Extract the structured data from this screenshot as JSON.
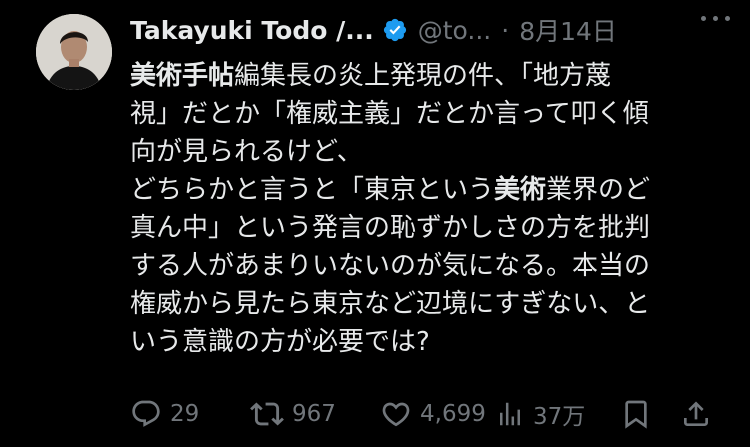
{
  "author": {
    "name": "Takayuki Todo /...",
    "handle": "@to...",
    "separator": "·",
    "date": "8月14日"
  },
  "icons": {
    "avatar": "profile-photo",
    "verified": "verified-badge-icon",
    "more": "more-dots-icon",
    "reply": "reply-icon",
    "retweet": "retweet-icon",
    "like": "heart-icon",
    "views": "views-bar-chart-icon",
    "bookmark": "bookmark-icon",
    "share": "share-icon"
  },
  "colors": {
    "background": "#000000",
    "text": "#e7e9ea",
    "muted": "#71767b",
    "verified": "#1d9bf0"
  },
  "tweet": {
    "lines": [
      [
        {
          "t": "美術手帖",
          "bold": true
        },
        {
          "t": "編集長の炎上発現の件、「地方蔑"
        }
      ],
      [
        {
          "t": "視」だとか「権威主義」だとか言って叩く傾"
        }
      ],
      [
        {
          "t": "向が見られるけど、"
        }
      ],
      [
        {
          "t": "どちらかと言うと「東京という"
        },
        {
          "t": "美術",
          "bold": true
        },
        {
          "t": "業界のど"
        }
      ],
      [
        {
          "t": "真ん中」という発言の恥ずかしさの方を批判"
        }
      ],
      [
        {
          "t": "する人があまりいないのが気になる。本当の"
        }
      ],
      [
        {
          "t": "権威から見たら東京など辺境にすぎない、と"
        }
      ],
      [
        {
          "t": "いう意識の方が必要では?"
        }
      ]
    ]
  },
  "stats": {
    "replies": "29",
    "retweets": "967",
    "likes": "4,699",
    "views": "37万"
  }
}
